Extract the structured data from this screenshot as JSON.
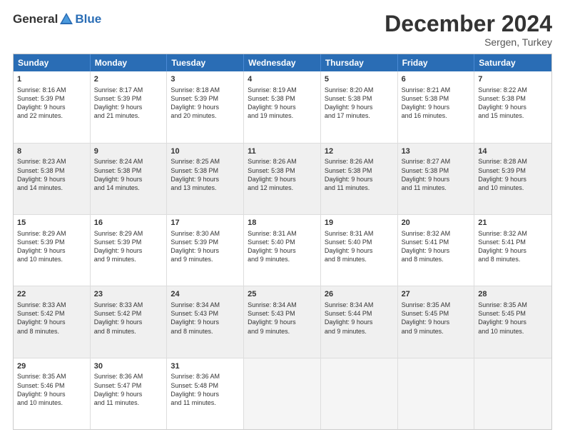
{
  "header": {
    "logo_general": "General",
    "logo_blue": "Blue",
    "month_title": "December 2024",
    "location": "Sergen, Turkey"
  },
  "days_of_week": [
    "Sunday",
    "Monday",
    "Tuesday",
    "Wednesday",
    "Thursday",
    "Friday",
    "Saturday"
  ],
  "weeks": [
    [
      {
        "day": "1",
        "lines": [
          "Sunrise: 8:16 AM",
          "Sunset: 5:39 PM",
          "Daylight: 9 hours",
          "and 22 minutes."
        ]
      },
      {
        "day": "2",
        "lines": [
          "Sunrise: 8:17 AM",
          "Sunset: 5:39 PM",
          "Daylight: 9 hours",
          "and 21 minutes."
        ]
      },
      {
        "day": "3",
        "lines": [
          "Sunrise: 8:18 AM",
          "Sunset: 5:39 PM",
          "Daylight: 9 hours",
          "and 20 minutes."
        ]
      },
      {
        "day": "4",
        "lines": [
          "Sunrise: 8:19 AM",
          "Sunset: 5:38 PM",
          "Daylight: 9 hours",
          "and 19 minutes."
        ]
      },
      {
        "day": "5",
        "lines": [
          "Sunrise: 8:20 AM",
          "Sunset: 5:38 PM",
          "Daylight: 9 hours",
          "and 17 minutes."
        ]
      },
      {
        "day": "6",
        "lines": [
          "Sunrise: 8:21 AM",
          "Sunset: 5:38 PM",
          "Daylight: 9 hours",
          "and 16 minutes."
        ]
      },
      {
        "day": "7",
        "lines": [
          "Sunrise: 8:22 AM",
          "Sunset: 5:38 PM",
          "Daylight: 9 hours",
          "and 15 minutes."
        ]
      }
    ],
    [
      {
        "day": "8",
        "lines": [
          "Sunrise: 8:23 AM",
          "Sunset: 5:38 PM",
          "Daylight: 9 hours",
          "and 14 minutes."
        ]
      },
      {
        "day": "9",
        "lines": [
          "Sunrise: 8:24 AM",
          "Sunset: 5:38 PM",
          "Daylight: 9 hours",
          "and 14 minutes."
        ]
      },
      {
        "day": "10",
        "lines": [
          "Sunrise: 8:25 AM",
          "Sunset: 5:38 PM",
          "Daylight: 9 hours",
          "and 13 minutes."
        ]
      },
      {
        "day": "11",
        "lines": [
          "Sunrise: 8:26 AM",
          "Sunset: 5:38 PM",
          "Daylight: 9 hours",
          "and 12 minutes."
        ]
      },
      {
        "day": "12",
        "lines": [
          "Sunrise: 8:26 AM",
          "Sunset: 5:38 PM",
          "Daylight: 9 hours",
          "and 11 minutes."
        ]
      },
      {
        "day": "13",
        "lines": [
          "Sunrise: 8:27 AM",
          "Sunset: 5:38 PM",
          "Daylight: 9 hours",
          "and 11 minutes."
        ]
      },
      {
        "day": "14",
        "lines": [
          "Sunrise: 8:28 AM",
          "Sunset: 5:39 PM",
          "Daylight: 9 hours",
          "and 10 minutes."
        ]
      }
    ],
    [
      {
        "day": "15",
        "lines": [
          "Sunrise: 8:29 AM",
          "Sunset: 5:39 PM",
          "Daylight: 9 hours",
          "and 10 minutes."
        ]
      },
      {
        "day": "16",
        "lines": [
          "Sunrise: 8:29 AM",
          "Sunset: 5:39 PM",
          "Daylight: 9 hours",
          "and 9 minutes."
        ]
      },
      {
        "day": "17",
        "lines": [
          "Sunrise: 8:30 AM",
          "Sunset: 5:39 PM",
          "Daylight: 9 hours",
          "and 9 minutes."
        ]
      },
      {
        "day": "18",
        "lines": [
          "Sunrise: 8:31 AM",
          "Sunset: 5:40 PM",
          "Daylight: 9 hours",
          "and 9 minutes."
        ]
      },
      {
        "day": "19",
        "lines": [
          "Sunrise: 8:31 AM",
          "Sunset: 5:40 PM",
          "Daylight: 9 hours",
          "and 8 minutes."
        ]
      },
      {
        "day": "20",
        "lines": [
          "Sunrise: 8:32 AM",
          "Sunset: 5:41 PM",
          "Daylight: 9 hours",
          "and 8 minutes."
        ]
      },
      {
        "day": "21",
        "lines": [
          "Sunrise: 8:32 AM",
          "Sunset: 5:41 PM",
          "Daylight: 9 hours",
          "and 8 minutes."
        ]
      }
    ],
    [
      {
        "day": "22",
        "lines": [
          "Sunrise: 8:33 AM",
          "Sunset: 5:42 PM",
          "Daylight: 9 hours",
          "and 8 minutes."
        ]
      },
      {
        "day": "23",
        "lines": [
          "Sunrise: 8:33 AM",
          "Sunset: 5:42 PM",
          "Daylight: 9 hours",
          "and 8 minutes."
        ]
      },
      {
        "day": "24",
        "lines": [
          "Sunrise: 8:34 AM",
          "Sunset: 5:43 PM",
          "Daylight: 9 hours",
          "and 8 minutes."
        ]
      },
      {
        "day": "25",
        "lines": [
          "Sunrise: 8:34 AM",
          "Sunset: 5:43 PM",
          "Daylight: 9 hours",
          "and 9 minutes."
        ]
      },
      {
        "day": "26",
        "lines": [
          "Sunrise: 8:34 AM",
          "Sunset: 5:44 PM",
          "Daylight: 9 hours",
          "and 9 minutes."
        ]
      },
      {
        "day": "27",
        "lines": [
          "Sunrise: 8:35 AM",
          "Sunset: 5:45 PM",
          "Daylight: 9 hours",
          "and 9 minutes."
        ]
      },
      {
        "day": "28",
        "lines": [
          "Sunrise: 8:35 AM",
          "Sunset: 5:45 PM",
          "Daylight: 9 hours",
          "and 10 minutes."
        ]
      }
    ],
    [
      {
        "day": "29",
        "lines": [
          "Sunrise: 8:35 AM",
          "Sunset: 5:46 PM",
          "Daylight: 9 hours",
          "and 10 minutes."
        ]
      },
      {
        "day": "30",
        "lines": [
          "Sunrise: 8:36 AM",
          "Sunset: 5:47 PM",
          "Daylight: 9 hours",
          "and 11 minutes."
        ]
      },
      {
        "day": "31",
        "lines": [
          "Sunrise: 8:36 AM",
          "Sunset: 5:48 PM",
          "Daylight: 9 hours",
          "and 11 minutes."
        ]
      },
      null,
      null,
      null,
      null
    ]
  ]
}
